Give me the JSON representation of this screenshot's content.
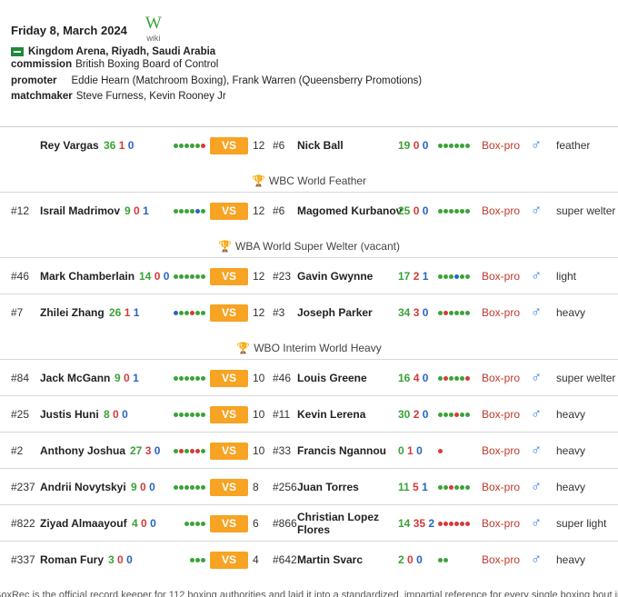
{
  "header": {
    "date": "Friday 8, March 2024",
    "wiki_glyph": "W",
    "wiki_label": "wiki",
    "venue": "Kingdom Arena, Riyadh, Saudi Arabia",
    "commission_key": "commission",
    "commission": "British Boxing Board of Control",
    "promoter_key": "promoter",
    "promoter": "Eddie Hearn (Matchroom Boxing), Frank Warren (Queensberry Promotions)",
    "matchmaker_key": "matchmaker",
    "matchmaker": "Steve Furness, Kevin Rooney Jr"
  },
  "labels": {
    "vs": "VS",
    "type": "Box-pro",
    "gender_icon": "♂"
  },
  "colors": {
    "win": "#3aa337",
    "loss": "#d63a3a",
    "draw": "#2a63c4",
    "vs_bg": "#f7a323",
    "type": "#c0392b",
    "gender": "#2a7ae2"
  },
  "bouts": [
    {
      "rank1": "",
      "name1": "Rey Vargas",
      "w1": "36",
      "l1": "1",
      "d1": "0",
      "form1": "WWWWWL",
      "rounds": "12",
      "rank2": "#6",
      "name2": "Nick Ball",
      "w2": "19",
      "l2": "0",
      "d2": "0",
      "form2": "WWWWWW",
      "weight": "feather",
      "title": "WBC World Feather"
    },
    {
      "rank1": "#12",
      "name1": "Israil Madrimov",
      "w1": "9",
      "l1": "0",
      "d1": "1",
      "form1": "WWWWDW",
      "rounds": "12",
      "rank2": "#6",
      "name2": "Magomed Kurbanov",
      "w2": "25",
      "l2": "0",
      "d2": "0",
      "form2": "WWWWWW",
      "weight": "super welter",
      "title": "WBA World Super Welter (vacant)"
    },
    {
      "rank1": "#46",
      "name1": "Mark Chamberlain",
      "w1": "14",
      "l1": "0",
      "d1": "0",
      "form1": "WWWWWW",
      "rounds": "12",
      "rank2": "#23",
      "name2": "Gavin Gwynne",
      "w2": "17",
      "l2": "2",
      "d2": "1",
      "form2": "WWWDWW",
      "weight": "light",
      "title": ""
    },
    {
      "rank1": "#7",
      "name1": "Zhilei Zhang",
      "w1": "26",
      "l1": "1",
      "d1": "1",
      "form1": "DWWLWW",
      "rounds": "12",
      "rank2": "#3",
      "name2": "Joseph Parker",
      "w2": "34",
      "l2": "3",
      "d2": "0",
      "form2": "WLWWWW",
      "weight": "heavy",
      "title": "WBO Interim World Heavy"
    },
    {
      "rank1": "#84",
      "name1": "Jack McGann",
      "w1": "9",
      "l1": "0",
      "d1": "1",
      "form1": "WWWWWW",
      "rounds": "10",
      "rank2": "#46",
      "name2": "Louis Greene",
      "w2": "16",
      "l2": "4",
      "d2": "0",
      "form2": "WLWWWL",
      "weight": "super welter",
      "title": ""
    },
    {
      "rank1": "#25",
      "name1": "Justis Huni",
      "w1": "8",
      "l1": "0",
      "d1": "0",
      "form1": "WWWWWW",
      "rounds": "10",
      "rank2": "#11",
      "name2": "Kevin Lerena",
      "w2": "30",
      "l2": "2",
      "d2": "0",
      "form2": "WWWLWW",
      "weight": "heavy",
      "title": ""
    },
    {
      "rank1": "#2",
      "name1": "Anthony Joshua",
      "w1": "27",
      "l1": "3",
      "d1": "0",
      "form1": "WLWLLW",
      "rounds": "10",
      "rank2": "#33",
      "name2": "Francis Ngannou",
      "w2": "0",
      "l2": "1",
      "d2": "0",
      "form2": "L",
      "weight": "heavy",
      "title": ""
    },
    {
      "rank1": "#237",
      "name1": "Andrii Novytskyi",
      "w1": "9",
      "l1": "0",
      "d1": "0",
      "form1": "WWWWWW",
      "rounds": "8",
      "rank2": "#256",
      "name2": "Juan Torres",
      "w2": "11",
      "l2": "5",
      "d2": "1",
      "form2": "WWLWWW",
      "weight": "heavy",
      "title": ""
    },
    {
      "rank1": "#822",
      "name1": "Ziyad Almaayouf",
      "w1": "4",
      "l1": "0",
      "d1": "0",
      "form1": "WWWW",
      "rounds": "6",
      "rank2": "#866",
      "name2": "Christian Lopez Flores",
      "w2": "14",
      "l2": "35",
      "d2": "2",
      "form2": "LLLLLL",
      "weight": "super light",
      "title": ""
    },
    {
      "rank1": "#337",
      "name1": "Roman Fury",
      "w1": "3",
      "l1": "0",
      "d1": "0",
      "form1": "WWW",
      "rounds": "4",
      "rank2": "#642",
      "name2": "Martin Svarc",
      "w2": "2",
      "l2": "0",
      "d2": "0",
      "form2": "WW",
      "weight": "heavy",
      "title": ""
    }
  ],
  "footer": "BoxRec is the official record keeper for 112 boxing authorities and laid it into a standardized, impartial reference for every single boxing bout in Dat"
}
